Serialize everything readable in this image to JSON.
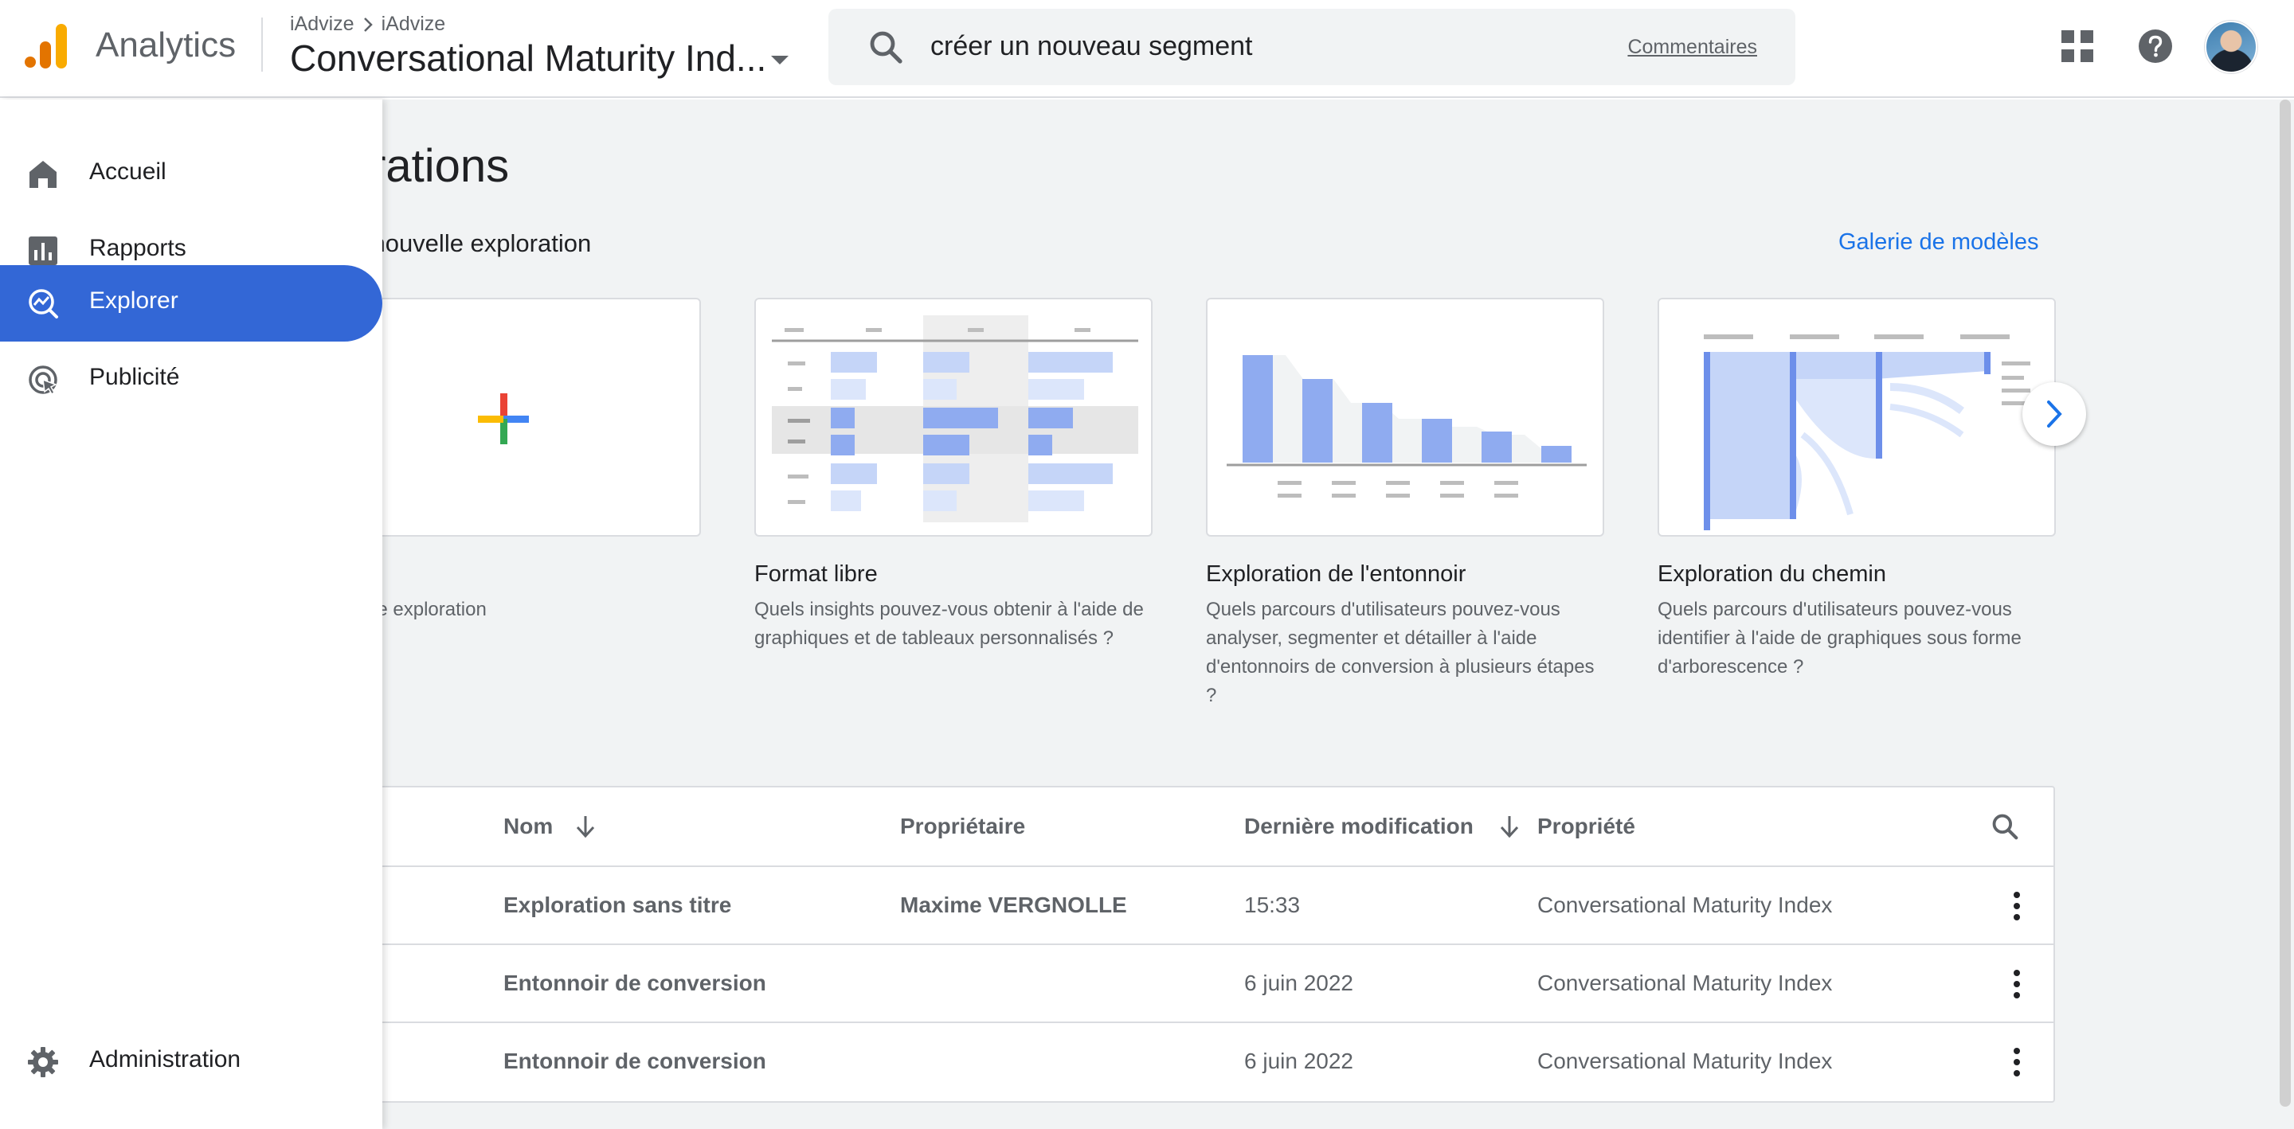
{
  "header": {
    "app_name": "Analytics",
    "breadcrumb": [
      "iAdvize",
      "iAdvize"
    ],
    "property_title": "Conversational Maturity Ind...",
    "search_query": "créer un nouveau segment",
    "feedback_label": "Commentaires"
  },
  "main": {
    "page_title": "Explorations",
    "section_subtitle": "Créer une nouvelle exploration",
    "gallery_link": "Galerie de modèles",
    "templates": [
      {
        "label": "",
        "description": "Créer une exploration",
        "icon": "plus-icon"
      },
      {
        "label": "Format libre",
        "description": "Quels insights pouvez-vous obtenir à l'aide de graphiques et de tableaux personnalisés ?"
      },
      {
        "label": "Exploration de l'entonnoir",
        "description": "Quels parcours d'utilisateurs pouvez-vous analyser, segmenter et détailler à l'aide d'entonnoirs de conversion à plusieurs étapes ?"
      },
      {
        "label": "Exploration du chemin",
        "description": "Quels parcours d'utilisateurs pouvez-vous identifier à l'aide de graphiques sous forme d'arborescence ?"
      }
    ],
    "table": {
      "headers": {
        "name": "Nom",
        "owner": "Propriétaire",
        "modified": "Dernière modification",
        "property": "Propriété"
      },
      "rows": [
        {
          "name": "Exploration sans titre",
          "owner": "Maxime VERGNOLLE",
          "modified": "15:33",
          "property": "Conversational Maturity Index"
        },
        {
          "name": "Entonnoir de conversion",
          "owner": "",
          "modified": "6 juin 2022",
          "property": "Conversational Maturity Index"
        },
        {
          "name": "Entonnoir de conversion",
          "owner": "",
          "modified": "6 juin 2022",
          "property": "Conversational Maturity Index"
        }
      ]
    }
  },
  "sidebar": {
    "items": [
      {
        "label": "Accueil",
        "icon": "home-icon"
      },
      {
        "label": "Rapports",
        "icon": "reports-icon"
      },
      {
        "label": "Explorer",
        "icon": "explore-icon",
        "active": true
      },
      {
        "label": "Publicité",
        "icon": "advertising-icon"
      }
    ],
    "admin_label": "Administration"
  },
  "colors": {
    "accent": "#3367d6",
    "link": "#1a73e8",
    "chart_blue": "#8fabf0",
    "logo_orange": "#f9ab00",
    "logo_dark_orange": "#e37400"
  }
}
